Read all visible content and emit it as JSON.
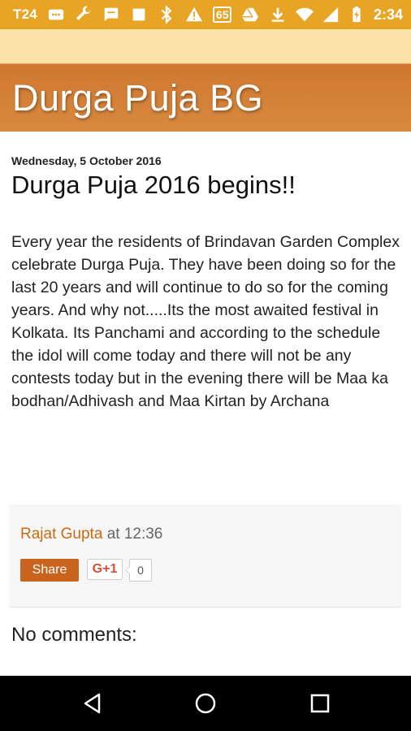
{
  "status_bar": {
    "carrier": "T24",
    "badge": "65",
    "time": "2:34",
    "icons": [
      "message-icon",
      "wrench-icon",
      "chat-icon",
      "square-icon",
      "bluetooth-off-icon",
      "warning-icon",
      "drive-icon",
      "download-icon",
      "wifi-icon",
      "signal-icon",
      "battery-charging-icon"
    ],
    "color": "#e8a424"
  },
  "header": {
    "title": "Durga Puja BG",
    "color": "#d07a35"
  },
  "post": {
    "date": "Wednesday, 5 October 2016",
    "title": "Durga Puja 2016 begins!!",
    "body": "Every year the residents of Brindavan Garden Complex celebrate Durga Puja. They have been doing so for the last 20 years and will continue to do so for the coming years. And why not.....Its the most awaited festival in Kolkata. Its Panchami and according to the schedule the idol will come today and there  will not be any contests today but in the evening there will be Maa ka bodhan/Adhivash and Maa Kirtan by Archana"
  },
  "footer": {
    "author": "Rajat Gupta",
    "at": "at",
    "time": "12:36",
    "share_label": "Share",
    "gplus_label": "G+1",
    "gplus_count": "0"
  },
  "comments": {
    "label": "No comments:"
  },
  "nav": {
    "icons": [
      "back-icon",
      "home-icon",
      "recents-icon"
    ]
  }
}
